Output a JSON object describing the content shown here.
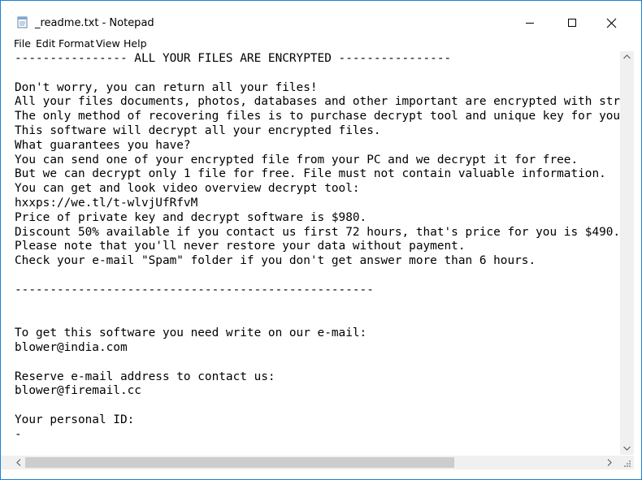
{
  "window": {
    "title": "_readme.txt - Notepad",
    "accent": "#1883d7"
  },
  "menu": {
    "items": [
      "File",
      "Edit",
      "Format",
      "View",
      "Help"
    ]
  },
  "document": {
    "lines": [
      "---------------- ALL YOUR FILES ARE ENCRYPTED ----------------",
      "",
      "Don't worry, you can return all your files!",
      "All your files documents, photos, databases and other important are encrypted with strong",
      "The only method of recovering files is to purchase decrypt tool and unique key for you.",
      "This software will decrypt all your encrypted files.",
      "What guarantees you have?",
      "You can send one of your encrypted file from your PC and we decrypt it for free.",
      "But we can decrypt only 1 file for free. File must not contain valuable information.",
      "You can get and look video overview decrypt tool:",
      "hxxps://we.tl/t-wlvjUfRfvM",
      "Price of private key and decrypt software is $980.",
      "Discount 50% available if you contact us first 72 hours, that's price for you is $490.",
      "Please note that you'll never restore your data without payment.",
      "Check your e-mail \"Spam\" folder if you don't get answer more than 6 hours.",
      "",
      "---------------------------------------------------",
      "",
      "",
      "To get this software you need write on our e-mail:",
      "blower@india.com",
      "",
      "Reserve e-mail address to contact us:",
      "blower@firemail.cc",
      "",
      "Your personal ID:",
      "-"
    ]
  },
  "icons": {
    "app": "notepad-icon",
    "minimize": "minimize-icon",
    "maximize": "maximize-icon",
    "close": "close-icon"
  }
}
